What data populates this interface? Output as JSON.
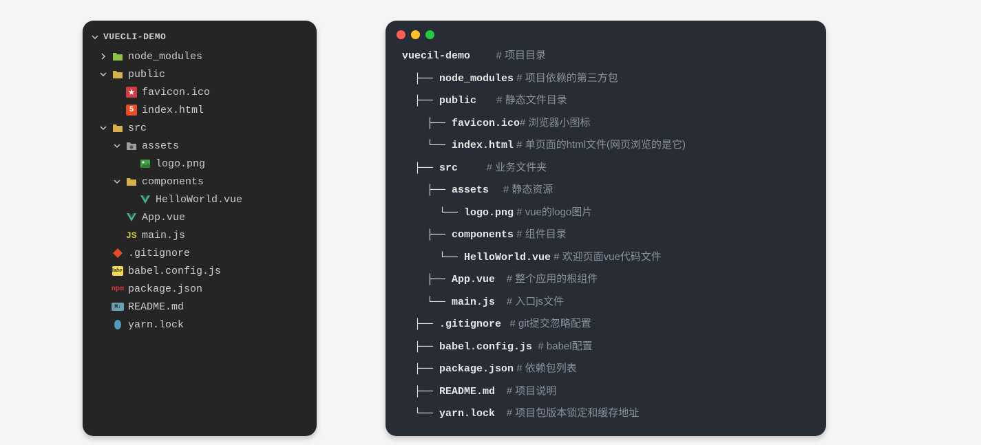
{
  "explorer": {
    "title": "VUECLI-DEMO",
    "items": [
      {
        "name": "node_modules",
        "type": "folder",
        "expanded": false,
        "indent": 1,
        "iconClass": "folder-green"
      },
      {
        "name": "public",
        "type": "folder",
        "expanded": true,
        "indent": 1,
        "iconClass": "folder-yellow"
      },
      {
        "name": "favicon.ico",
        "type": "file",
        "indent": 2,
        "iconClass": "star-icon"
      },
      {
        "name": "index.html",
        "type": "file",
        "indent": 2,
        "iconClass": "html5-icon"
      },
      {
        "name": "src",
        "type": "folder",
        "expanded": true,
        "indent": 1,
        "iconClass": "folder-yellow"
      },
      {
        "name": "assets",
        "type": "folder",
        "expanded": true,
        "indent": 2,
        "iconClass": "folder-gray"
      },
      {
        "name": "logo.png",
        "type": "file",
        "indent": 3,
        "iconClass": "image-icon"
      },
      {
        "name": "components",
        "type": "folder",
        "expanded": true,
        "indent": 2,
        "iconClass": "folder-yellow"
      },
      {
        "name": "HelloWorld.vue",
        "type": "file",
        "indent": 3,
        "iconClass": "vue-icon"
      },
      {
        "name": "App.vue",
        "type": "file",
        "indent": 2,
        "iconClass": "vue-icon"
      },
      {
        "name": "main.js",
        "type": "file",
        "indent": 2,
        "iconClass": "js-icon"
      },
      {
        "name": ".gitignore",
        "type": "file",
        "indent": 1,
        "iconClass": "git-icon"
      },
      {
        "name": "babel.config.js",
        "type": "file",
        "indent": 1,
        "iconClass": "babel-icon"
      },
      {
        "name": "package.json",
        "type": "file",
        "indent": 1,
        "iconClass": "json-icon"
      },
      {
        "name": "README.md",
        "type": "file",
        "indent": 1,
        "iconClass": "md-icon"
      },
      {
        "name": "yarn.lock",
        "type": "file",
        "indent": 1,
        "iconClass": "yarn-icon"
      }
    ]
  },
  "terminal": {
    "lines": [
      {
        "branch": "",
        "name": "vuecil-demo",
        "spacer": "         ",
        "comment": "# 项目目录"
      },
      {
        "branch": "  ├── ",
        "name": "node_modules",
        "spacer": " ",
        "comment": "# 项目依赖的第三方包"
      },
      {
        "branch": "  ├── ",
        "name": "public",
        "spacer": "       ",
        "comment": "# 静态文件目录"
      },
      {
        "branch": "    ├── ",
        "name": "favicon.ico",
        "spacer": "",
        "comment": "# 浏览器小图标"
      },
      {
        "branch": "    └── ",
        "name": "index.html",
        "spacer": " ",
        "comment": "# 单页面的html文件(网页浏览的是它)"
      },
      {
        "branch": "  ├── ",
        "name": "src",
        "spacer": "          ",
        "comment": "# 业务文件夹"
      },
      {
        "branch": "    ├── ",
        "name": "assets",
        "spacer": "     ",
        "comment": "# 静态资源"
      },
      {
        "branch": "      └── ",
        "name": "logo.png",
        "spacer": " ",
        "comment": "# vue的logo图片"
      },
      {
        "branch": "    ├── ",
        "name": "components",
        "spacer": " ",
        "comment": "# 组件目录"
      },
      {
        "branch": "      └── ",
        "name": "HelloWorld.vue",
        "spacer": " ",
        "comment": "# 欢迎页面vue代码文件"
      },
      {
        "branch": "    ├── ",
        "name": "App.vue",
        "spacer": "    ",
        "comment": "# 整个应用的根组件"
      },
      {
        "branch": "    └── ",
        "name": "main.js",
        "spacer": "    ",
        "comment": "# 入口js文件"
      },
      {
        "branch": "  ├── ",
        "name": ".gitignore",
        "spacer": "   ",
        "comment": "# git提交忽略配置"
      },
      {
        "branch": "  ├── ",
        "name": "babel.config.js",
        "spacer": "  ",
        "comment": "# babel配置"
      },
      {
        "branch": "  ├── ",
        "name": "package.json",
        "spacer": " ",
        "comment": "# 依赖包列表"
      },
      {
        "branch": "  ├── ",
        "name": "README.md",
        "spacer": "    ",
        "comment": "# 项目说明"
      },
      {
        "branch": "  └── ",
        "name": "yarn.lock",
        "spacer": "    ",
        "comment": "# 项目包版本锁定和缓存地址"
      }
    ]
  }
}
